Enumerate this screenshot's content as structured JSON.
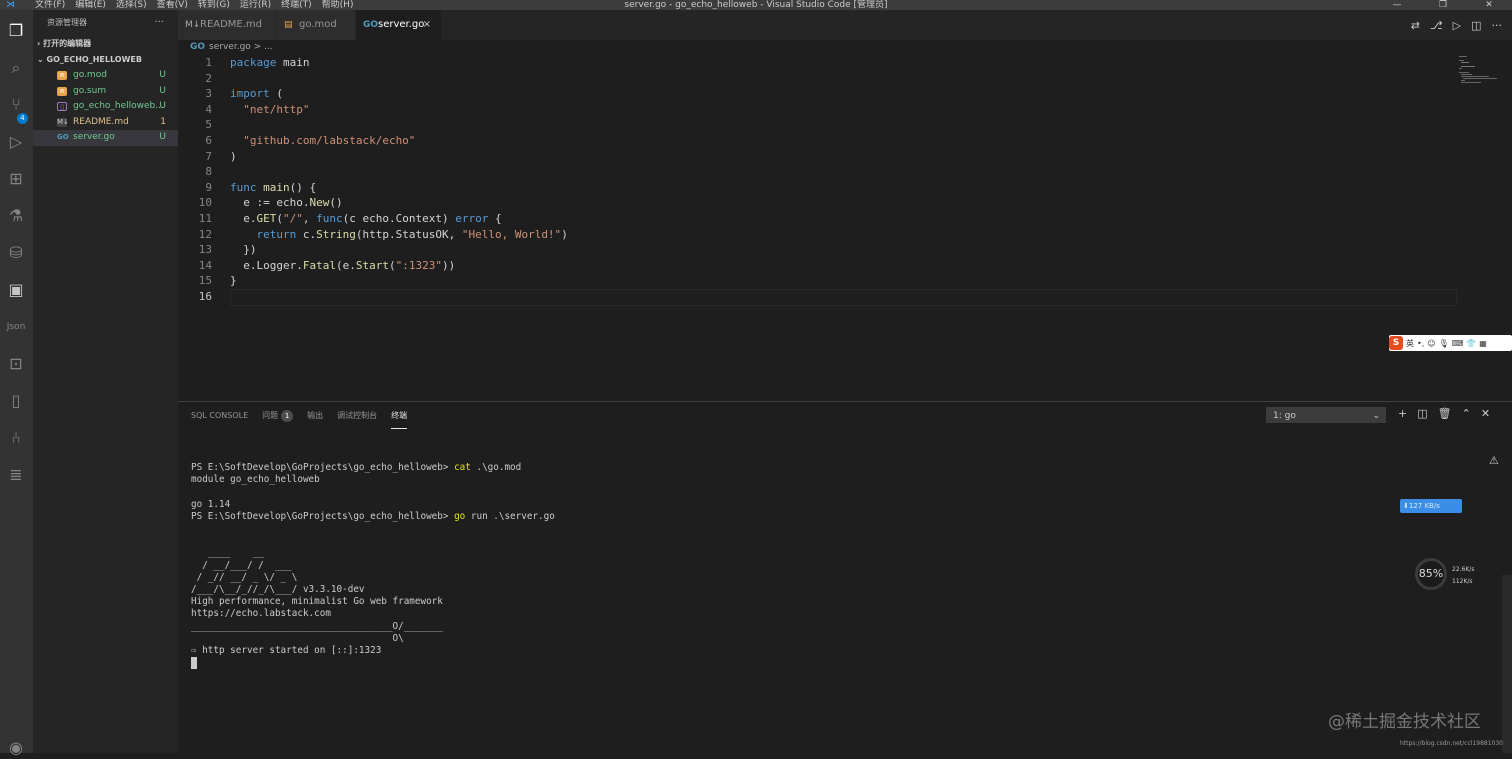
{
  "menu": [
    "文件(F)",
    "编辑(E)",
    "选择(S)",
    "查看(V)",
    "转到(G)",
    "运行(R)",
    "终端(T)",
    "帮助(H)"
  ],
  "window_title": "server.go - go_echo_helloweb - Visual Studio Code [管理员]",
  "activity_badge": "4",
  "sidebar": {
    "header": "资源管理器",
    "more": "···",
    "open_editors": "打开的编辑器",
    "folder": "GO_ECHO_HELLOWEB",
    "files": [
      {
        "name": "go.mod",
        "status": "U"
      },
      {
        "name": "go.sum",
        "status": "U"
      },
      {
        "name": "go_echo_helloweb...",
        "status": "U"
      },
      {
        "name": "README.md",
        "status": "1"
      },
      {
        "name": "server.go",
        "status": "U"
      }
    ]
  },
  "tabs": [
    {
      "label": "README.md"
    },
    {
      "label": "go.mod"
    },
    {
      "label": "server.go",
      "close": "×"
    }
  ],
  "breadcrumb": {
    "file": "server.go",
    "rest": " > ..."
  },
  "code_lines": [
    "1",
    "2",
    "3",
    "4",
    "5",
    "6",
    "7",
    "8",
    "9",
    "10",
    "11",
    "12",
    "13",
    "14",
    "15",
    "16"
  ],
  "code": {
    "l1a": "package",
    "l1b": " main",
    "l3a": "import",
    "l3b": " (",
    "l4": "  \"net/http\"",
    "l6": "  \"github.com/labstack/echo\"",
    "l7": ")",
    "l9a": "func",
    "l9b": " main",
    "l9c": "() {",
    "l10a": "  e := echo.",
    "l10b": "New",
    "l10c": "()",
    "l11a": "  e.",
    "l11b": "GET",
    "l11c": "(",
    "l11d": "\"/\"",
    "l11e": ", ",
    "l11f": "func",
    "l11g": "(c echo.Context) ",
    "l11h": "error",
    "l11i": " {",
    "l12a": "    ",
    "l12b": "return",
    "l12c": " c.",
    "l12d": "String",
    "l12e": "(http.StatusOK, ",
    "l12f": "\"Hello, World!\"",
    "l12g": ")",
    "l13": "  })",
    "l14a": "  e.Logger.",
    "l14b": "Fatal",
    "l14c": "(e.",
    "l14d": "Start",
    "l14e": "(",
    "l14f": "\":1323\"",
    "l14g": "))",
    "l15": "}"
  },
  "panel": {
    "tabs": [
      "SQL CONSOLE",
      "问题",
      "输出",
      "调试控制台",
      "终端"
    ],
    "problems_count": "1",
    "terminal_select": "1: go",
    "terminal_lines": {
      "p1": "PS E:\\SoftDevelop\\GoProjects\\go_echo_helloweb> ",
      "c1": "cat",
      "a1": " .\\go.mod",
      "o1": "module go_echo_helloweb",
      "o2": "go 1.14",
      "p2": "PS E:\\SoftDevelop\\GoProjects\\go_echo_helloweb> ",
      "c2": "go",
      "a2": " run .\\server.go",
      "art1": "   ____    __",
      "art2": "  / __/___/ /  ___",
      "art3": " / _// __/ _ \\/ _ \\",
      "art4": "/___/\\__/_//_/\\___/ v3.3.10-dev",
      "o3": "High performance, minimalist Go web framework",
      "o4": "https://echo.labstack.com",
      "o5": "____________________________________O/_______",
      "o6": "                                    O\\",
      "o7": "⇨ http server started on [::]:1323"
    }
  },
  "overlay": {
    "ime_label": "英",
    "net_speed": "⬇127 KB/s",
    "gauge": "85%",
    "up": "22.6K/s",
    "down": "112K/s",
    "watermark": "@稀土掘金技术社区",
    "watermark_url": "https://blog.csdn.net/ccl19881030"
  }
}
